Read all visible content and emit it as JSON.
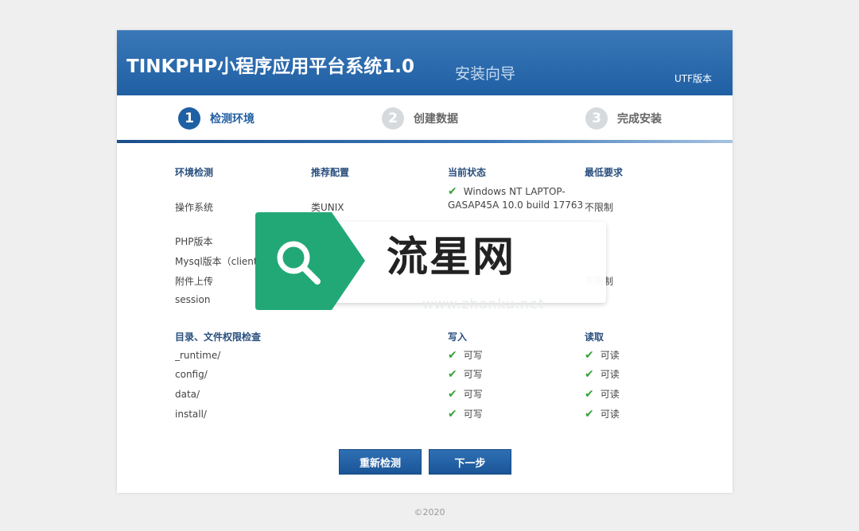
{
  "header": {
    "title": "TINKPHP小程序应用平台系统1.0",
    "subtitle": "安装向导",
    "charset": "UTF版本"
  },
  "steps": [
    {
      "num": "1",
      "label": "检测环境"
    },
    {
      "num": "2",
      "label": "创建数据"
    },
    {
      "num": "3",
      "label": "完成安装"
    }
  ],
  "env": {
    "headers": [
      "环境检测",
      "推荐配置",
      "当前状态",
      "最低要求"
    ],
    "rows": [
      {
        "name": "操作系统",
        "recommended": "类UNIX",
        "current": "Windows NT LAPTOP-",
        "current2": "GASAP45A 10.0 build 17763",
        "min": "不限制"
      },
      {
        "name": "PHP版本",
        "recommended": "",
        "current": "",
        "min": ""
      },
      {
        "name": "Mysql版本（client)",
        "recommended": "",
        "current": "",
        "min": ""
      },
      {
        "name": "附件上传",
        "recommended": "",
        "current": "",
        "min": "不限制"
      },
      {
        "name": "session",
        "recommended": "",
        "current": "",
        "min": ""
      }
    ]
  },
  "perm": {
    "headers": [
      "目录、文件权限检查",
      "写入",
      "读取"
    ],
    "rows": [
      {
        "name": "_runtime/",
        "write": "可写",
        "read": "可读"
      },
      {
        "name": "config/",
        "write": "可写",
        "read": "可读"
      },
      {
        "name": "data/",
        "write": "可写",
        "read": "可读"
      },
      {
        "name": "install/",
        "write": "可写",
        "read": "可读"
      }
    ]
  },
  "buttons": {
    "recheck": "重新检测",
    "next": "下一步"
  },
  "footer": "©2020",
  "watermark": {
    "text": "流星网",
    "url": "www.zhanku.net",
    "accent": "#22a877"
  },
  "colors": {
    "header": "#1f5fa3",
    "ok": "#3aa33a"
  }
}
